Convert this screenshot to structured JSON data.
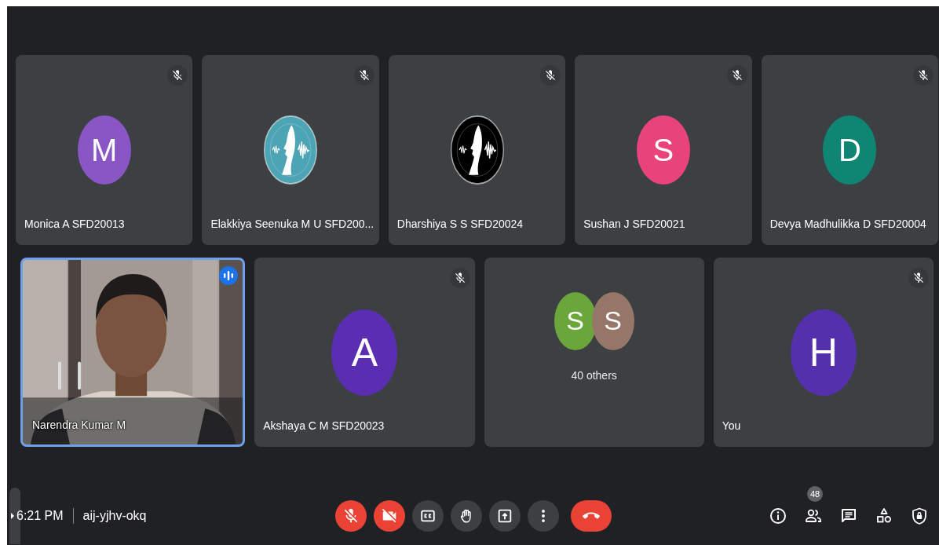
{
  "rows": [
    {
      "tiles": [
        {
          "kind": "avatar",
          "name": "Monica A SFD20013",
          "initial": "M",
          "color": "#8a55c4",
          "muted": true
        },
        {
          "kind": "logo",
          "name": "Elakkiya Seenuka M U SFD200...",
          "color": "#4ca4b4",
          "muted": true
        },
        {
          "kind": "logo",
          "name": "Dharshiya S S SFD20024",
          "color": "#000000",
          "muted": true
        },
        {
          "kind": "avatar",
          "name": "Sushan J SFD20021",
          "initial": "S",
          "color": "#e8437a",
          "muted": true
        },
        {
          "kind": "avatar",
          "name": "Devya Madhulikka D SFD20004",
          "initial": "D",
          "color": "#0f8574",
          "muted": true
        }
      ]
    },
    {
      "tiles": [
        {
          "kind": "video",
          "name": "Narendra Kumar M",
          "speaking": true
        },
        {
          "kind": "avatar",
          "name": "Akshaya C M SFD20023",
          "initial": "A",
          "color": "#5b2db0",
          "muted": true
        },
        {
          "kind": "group",
          "avatars": [
            {
              "initial": "S",
              "color": "#6aa63a"
            },
            {
              "initial": "S",
              "color": "#967669"
            }
          ],
          "label": "40 others"
        },
        {
          "kind": "avatar",
          "name": "You",
          "initial": "H",
          "color": "#5430ad",
          "muted": true
        }
      ]
    }
  ],
  "bottom_bar": {
    "time": "6:21 PM",
    "meeting_code": "aij-yjhv-okq",
    "controls": [
      {
        "kind": "mic",
        "on": false
      },
      {
        "kind": "camera",
        "on": false
      },
      {
        "kind": "captions",
        "on": false
      },
      {
        "kind": "hand"
      },
      {
        "kind": "present"
      },
      {
        "kind": "more"
      },
      {
        "kind": "leave"
      }
    ],
    "side_controls": [
      {
        "kind": "info"
      },
      {
        "kind": "people",
        "badge": "48"
      },
      {
        "kind": "chat"
      },
      {
        "kind": "activities"
      },
      {
        "kind": "safety"
      }
    ]
  }
}
